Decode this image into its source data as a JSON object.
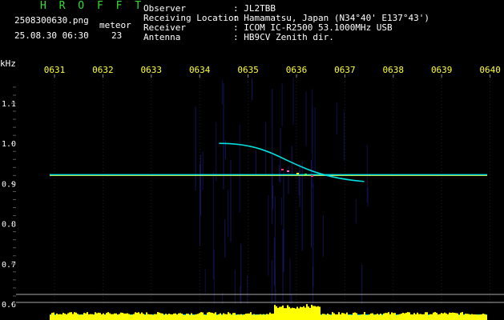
{
  "header": {
    "app_name": "H R O F F T",
    "filename": "2508300630.png",
    "datetime": "25.08.30 06:30",
    "count_label": "meteor",
    "count_value": "23",
    "info": [
      {
        "label": "Observer",
        "value": ": JL2TBB"
      },
      {
        "label": "Receiving Location",
        "value": ": Hamamatsu, Japan (N34°40' E137°43')"
      },
      {
        "label": "Receiver",
        "value": ": ICOM IC-R2500 53.1000MHz USB"
      },
      {
        "label": "Antenna",
        "value": ": HB9CV Zenith dir."
      }
    ]
  },
  "colors": {
    "app_name": "#33dd33",
    "text": "#ffffff",
    "time_labels": "#ffff33",
    "axis_labels": "#ffffff",
    "guide_line": "#ffff33",
    "trace": "#00e0e0",
    "spectrum_bar": "#ffff00",
    "spectrum_base": "#00ccff"
  },
  "chart_data": {
    "type": "spectrogram",
    "ylabel": "kHz",
    "y_ticks": [
      "1.1",
      "1.0",
      "0.9",
      "0.8",
      "0.7",
      "0.6"
    ],
    "x_ticks": [
      "0631",
      "0632",
      "0633",
      "0634",
      "0635",
      "0636",
      "0637",
      "0638",
      "0639",
      "0640"
    ],
    "ylim": [
      0.59,
      1.16
    ],
    "carrier_khz": 0.922,
    "meteor_echo": {
      "start_time": "0634.4",
      "end_time": "0637.4",
      "start_khz": 1.0,
      "end_khz": 0.905
    }
  }
}
